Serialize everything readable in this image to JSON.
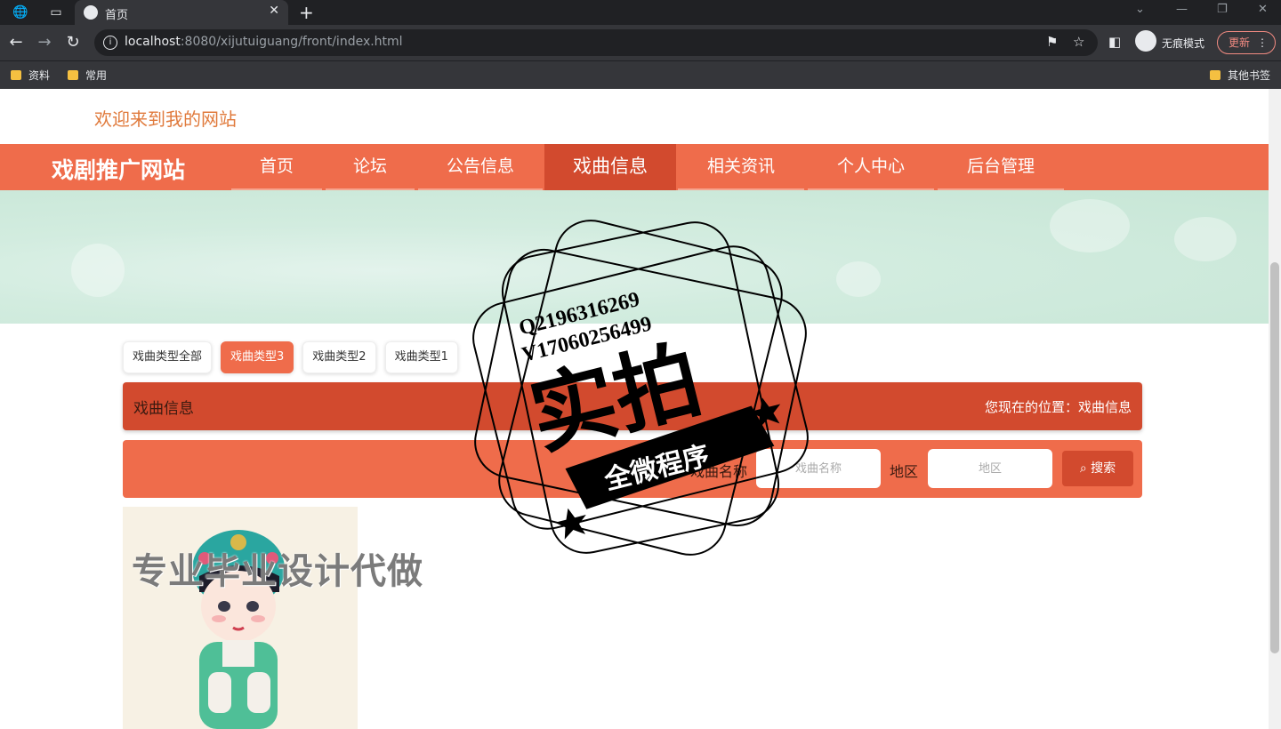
{
  "browser": {
    "tab_title": "首页",
    "url_host": "localhost",
    "url_rest": ":8080/xijutuiguang/front/index.html",
    "incognito_label": "无痕模式",
    "update_label": "更新",
    "bookmarks": [
      "资料",
      "常用"
    ],
    "other_bookmarks": "其他书签"
  },
  "page": {
    "welcome": "欢迎来到我的网站",
    "brand": "戏剧推广网站",
    "nav": [
      "首页",
      "论坛",
      "公告信息",
      "戏曲信息",
      "相关资讯",
      "个人中心",
      "后台管理"
    ],
    "active_nav": "戏曲信息",
    "categories": [
      "戏曲类型全部",
      "戏曲类型3",
      "戏曲类型2",
      "戏曲类型1"
    ],
    "active_category": "戏曲类型3",
    "section_title": "戏曲信息",
    "location_label": "您现在的位置：",
    "location_value": "戏曲信息",
    "search": {
      "name_label": "戏曲名称",
      "name_placeholder": "戏曲名称",
      "region_label": "地区",
      "region_placeholder": "地区",
      "button": "搜索"
    }
  },
  "overlays": {
    "watermark_text": "专业毕业设计代做",
    "stamp_line1": "Q2196316269",
    "stamp_line2": "V17060256499",
    "stamp_big": "实拍",
    "stamp_ribbon": "全微程序"
  },
  "colors": {
    "nav_bg": "#ef6c4b",
    "nav_active": "#d24a2e",
    "welcome_text": "#e07a3c"
  }
}
